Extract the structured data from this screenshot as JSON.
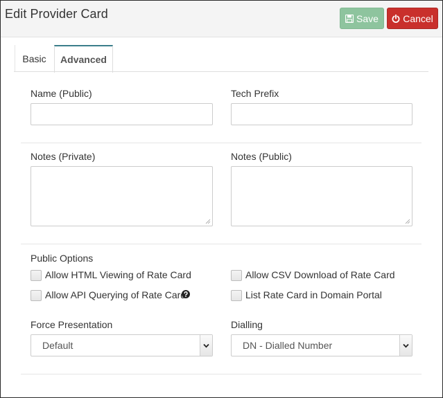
{
  "header": {
    "title": "Edit Provider Card",
    "save_label": "Save",
    "cancel_label": "Cancel"
  },
  "tabs": [
    {
      "label": "Basic",
      "active": false
    },
    {
      "label": "Advanced",
      "active": true
    }
  ],
  "form": {
    "name_public": {
      "label": "Name (Public)",
      "value": ""
    },
    "tech_prefix": {
      "label": "Tech Prefix",
      "value": ""
    },
    "notes_private": {
      "label": "Notes (Private)",
      "value": ""
    },
    "notes_public": {
      "label": "Notes (Public)",
      "value": ""
    },
    "public_options": {
      "heading": "Public Options",
      "options": [
        {
          "label": "Allow HTML Viewing of Rate Card",
          "checked": false
        },
        {
          "label": "Allow CSV Download of Rate Card",
          "checked": false
        },
        {
          "label": "Allow API Querying of Rate Card",
          "checked": false,
          "help": true
        },
        {
          "label": "List Rate Card in Domain Portal",
          "checked": false
        }
      ]
    },
    "force_presentation": {
      "label": "Force Presentation",
      "selected": "Default"
    },
    "dialling": {
      "label": "Dialling",
      "selected": "DN - Dialled Number"
    }
  },
  "colors": {
    "save_button": "#8ec49e",
    "cancel_button": "#c9302c",
    "active_tab_accent": "#3a7d8a"
  },
  "icons": {
    "save": "floppy-disk-icon",
    "cancel": "power-icon",
    "help": "question-circle-icon",
    "select_arrow": "chevron-down-icon"
  }
}
